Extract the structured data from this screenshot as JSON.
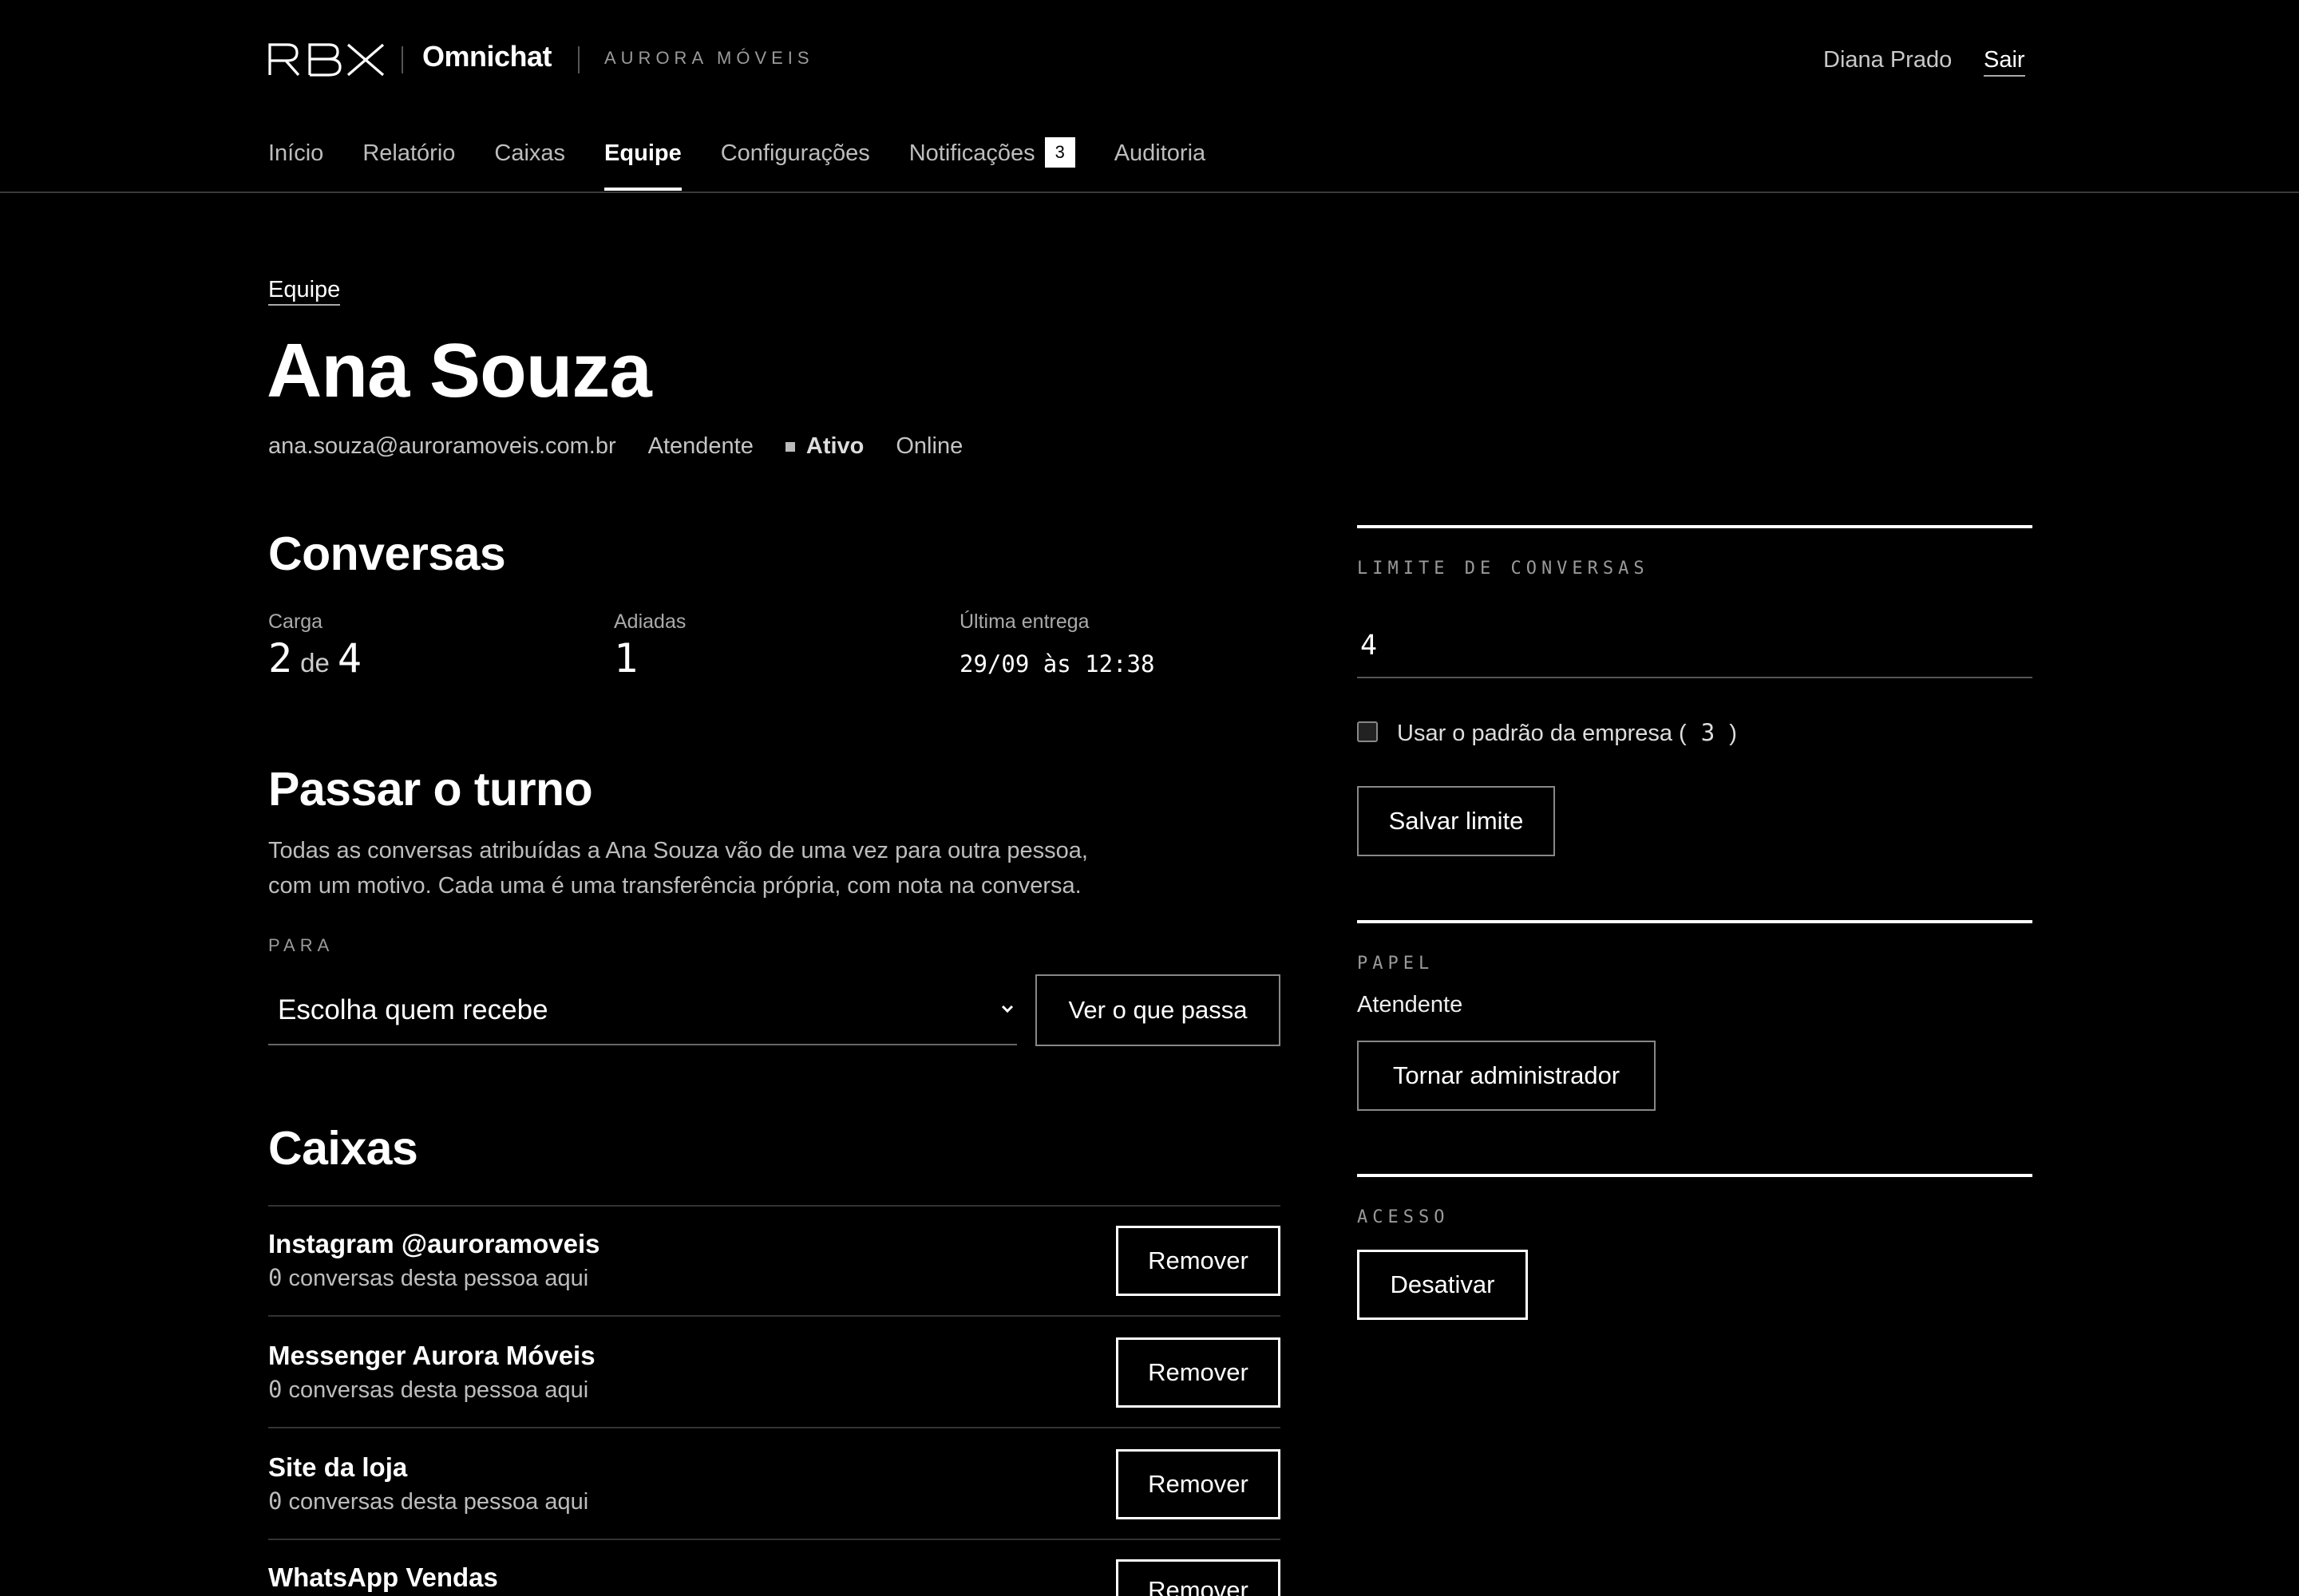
{
  "header": {
    "logo_text": "RBX",
    "app_name": "Omnichat",
    "company": "AURORA MÓVEIS",
    "user_name": "Diana Prado",
    "logout_label": "Sair"
  },
  "nav": {
    "items": [
      {
        "label": "Início"
      },
      {
        "label": "Relatório"
      },
      {
        "label": "Caixas"
      },
      {
        "label": "Equipe"
      },
      {
        "label": "Configurações"
      },
      {
        "label": "Notificações",
        "badge": "3"
      },
      {
        "label": "Auditoria"
      }
    ],
    "active": "Equipe"
  },
  "breadcrumb": "Equipe",
  "agent": {
    "name": "Ana Souza",
    "email": "ana.souza@auroramoveis.com.br",
    "role": "Atendente",
    "status": "Ativo",
    "presence": "Online"
  },
  "conversations": {
    "title": "Conversas",
    "load_label": "Carga",
    "load_current": "2",
    "load_of": "de",
    "load_max": "4",
    "snoozed_label": "Adiadas",
    "snoozed_value": "1",
    "last_label": "Última entrega",
    "last_value": "29/09 às 12:38"
  },
  "handoff": {
    "title": "Passar o turno",
    "description_line1": "Todas as conversas atribuídas a Ana Souza vão de uma vez para outra pessoa,",
    "description_line2": "com um motivo. Cada uma é uma transferência própria, com nota na conversa.",
    "to_label": "PARA",
    "select_placeholder": "Escolha quem recebe",
    "preview_button": "Ver o que passa"
  },
  "inboxes": {
    "title": "Caixas",
    "count_suffix": "conversas desta pessoa aqui",
    "remove_label": "Remover",
    "items": [
      {
        "name": "Instagram @auroramoveis",
        "count": "0"
      },
      {
        "name": "Messenger Aurora Móveis",
        "count": "0"
      },
      {
        "name": "Site da loja",
        "count": "0"
      },
      {
        "name": "WhatsApp Vendas",
        "count": ""
      }
    ]
  },
  "limit": {
    "label": "LIMITE DE CONVERSAS",
    "value": "4",
    "default_label_prefix": "Usar o padrão da empresa (",
    "default_value": "3",
    "default_label_suffix": ")",
    "default_checked": false,
    "save_button": "Salvar limite"
  },
  "role_section": {
    "label": "PAPEL",
    "value": "Atendente",
    "button": "Tornar administrador"
  },
  "access": {
    "label": "ACESSO",
    "button": "Desativar"
  }
}
